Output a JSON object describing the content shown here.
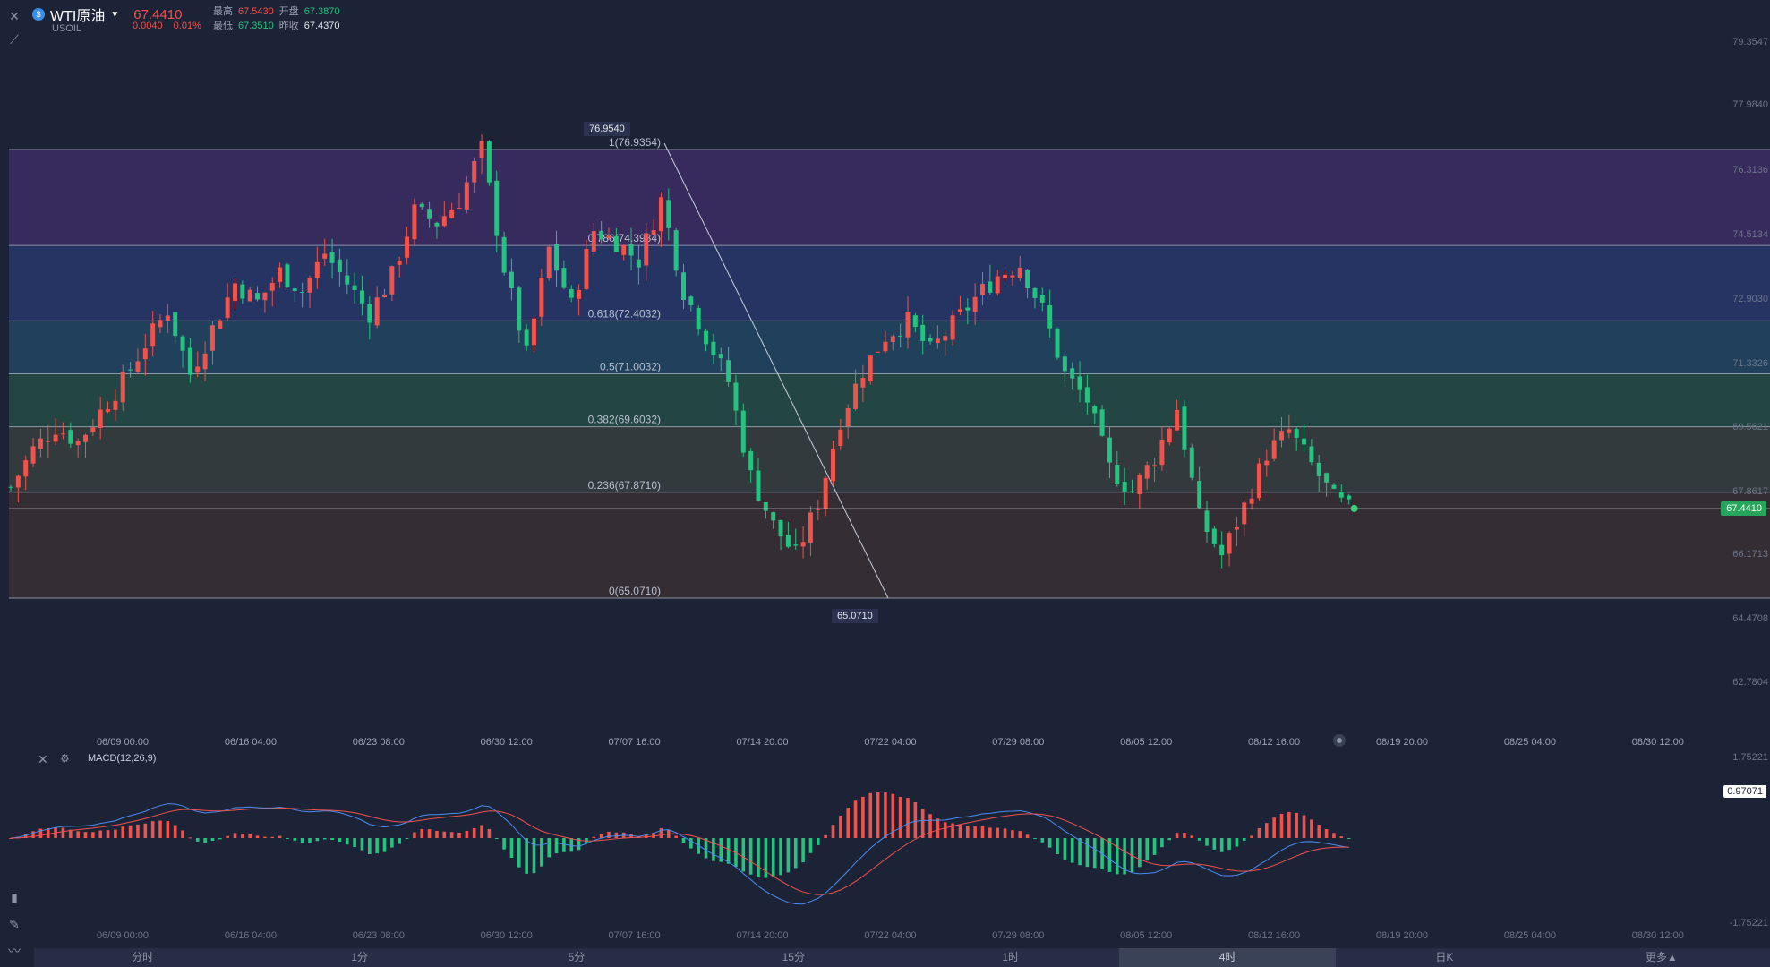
{
  "header": {
    "symbol_name": "WTI原油",
    "symbol_code": "USOIL",
    "last_price": "67.4410",
    "change": "0.0040",
    "change_pct": "0.01%",
    "stats": {
      "high_label": "最高",
      "high": "67.5430",
      "open_label": "开盘",
      "open": "67.3870",
      "low_label": "最低",
      "low": "67.3510",
      "prev_label": "昨收",
      "prev": "67.4370"
    }
  },
  "markers": {
    "high_tag": "76.9540",
    "low_tag": "65.0710",
    "last_tag": "67.4410",
    "macd_tag": "0.97071"
  },
  "macd": {
    "label": "MACD(12,26,9)",
    "axis_top": "1.75221",
    "axis_bottom": "-1.75221"
  },
  "timeframes": [
    "分时",
    "1分",
    "5分",
    "15分",
    "1时",
    "4时",
    "日K",
    "更多▲"
  ],
  "active_timeframe": "4时",
  "colors": {
    "background": "#1d2337",
    "up": "#f0524c",
    "down": "#26c281",
    "macd_dif": "#4a8df0",
    "macd_dea": "#f0524c"
  },
  "chart_data": {
    "type": "candlestick",
    "price_axis_labels": [
      "79.3547",
      "77.9840",
      "76.3136",
      "74.5134",
      "72.9030",
      "71.3326",
      "69.5621",
      "67.8617",
      "66.1713",
      "64.4708",
      "62.7804"
    ],
    "time_labels": [
      "06/09 00:00",
      "06/16 04:00",
      "06/23 08:00",
      "06/30 12:00",
      "07/07 16:00",
      "07/14 20:00",
      "07/22 04:00",
      "07/29 08:00",
      "08/05 12:00",
      "08/12 16:00",
      "08/19 20:00",
      "08/25 04:00",
      "08/30 12:00"
    ],
    "fibonacci": [
      {
        "label": "1(76.9354)",
        "price": 76.9354
      },
      {
        "label": "0.786(74.3984)",
        "price": 74.3984
      },
      {
        "label": "0.618(72.4032)",
        "price": 72.4032
      },
      {
        "label": "0.5(71.0032)",
        "price": 71.0032
      },
      {
        "label": "0.382(69.6032)",
        "price": 69.6032
      },
      {
        "label": "0.236(67.8710)",
        "price": 67.871
      },
      {
        "label": "0(65.0710)",
        "price": 65.071
      }
    ],
    "close_path": [
      [
        0,
        68.0
      ],
      [
        3,
        69.0
      ],
      [
        6,
        69.6
      ],
      [
        9,
        69.2
      ],
      [
        12,
        70.0
      ],
      [
        15,
        70.8
      ],
      [
        18,
        71.8
      ],
      [
        21,
        72.7
      ],
      [
        24,
        71.0
      ],
      [
        27,
        72.2
      ],
      [
        30,
        73.4
      ],
      [
        33,
        72.9
      ],
      [
        36,
        73.7
      ],
      [
        39,
        73.2
      ],
      [
        42,
        74.2
      ],
      [
        45,
        73.4
      ],
      [
        48,
        72.6
      ],
      [
        51,
        73.6
      ],
      [
        54,
        75.3
      ],
      [
        57,
        75.0
      ],
      [
        60,
        75.6
      ],
      [
        63,
        76.95
      ],
      [
        66,
        73.8
      ],
      [
        69,
        71.5
      ],
      [
        72,
        74.3
      ],
      [
        75,
        72.8
      ],
      [
        78,
        74.8
      ],
      [
        81,
        74.5
      ],
      [
        84,
        74.0
      ],
      [
        87,
        75.6
      ],
      [
        90,
        73.2
      ],
      [
        93,
        72.0
      ],
      [
        96,
        70.8
      ],
      [
        99,
        68.3
      ],
      [
        102,
        67.0
      ],
      [
        105,
        66.2
      ],
      [
        108,
        67.6
      ],
      [
        111,
        69.8
      ],
      [
        114,
        71.1
      ],
      [
        117,
        72.0
      ],
      [
        120,
        72.4
      ],
      [
        123,
        71.6
      ],
      [
        126,
        72.3
      ],
      [
        129,
        73.0
      ],
      [
        132,
        73.6
      ],
      [
        135,
        73.9
      ],
      [
        138,
        72.7
      ],
      [
        141,
        71.0
      ],
      [
        144,
        70.3
      ],
      [
        147,
        68.5
      ],
      [
        150,
        67.9
      ],
      [
        153,
        68.8
      ],
      [
        156,
        70.1
      ],
      [
        159,
        67.2
      ],
      [
        162,
        66.2
      ],
      [
        165,
        67.5
      ],
      [
        168,
        68.9
      ],
      [
        171,
        69.5
      ],
      [
        174,
        68.6
      ],
      [
        177,
        67.7
      ],
      [
        179,
        67.44
      ]
    ]
  }
}
